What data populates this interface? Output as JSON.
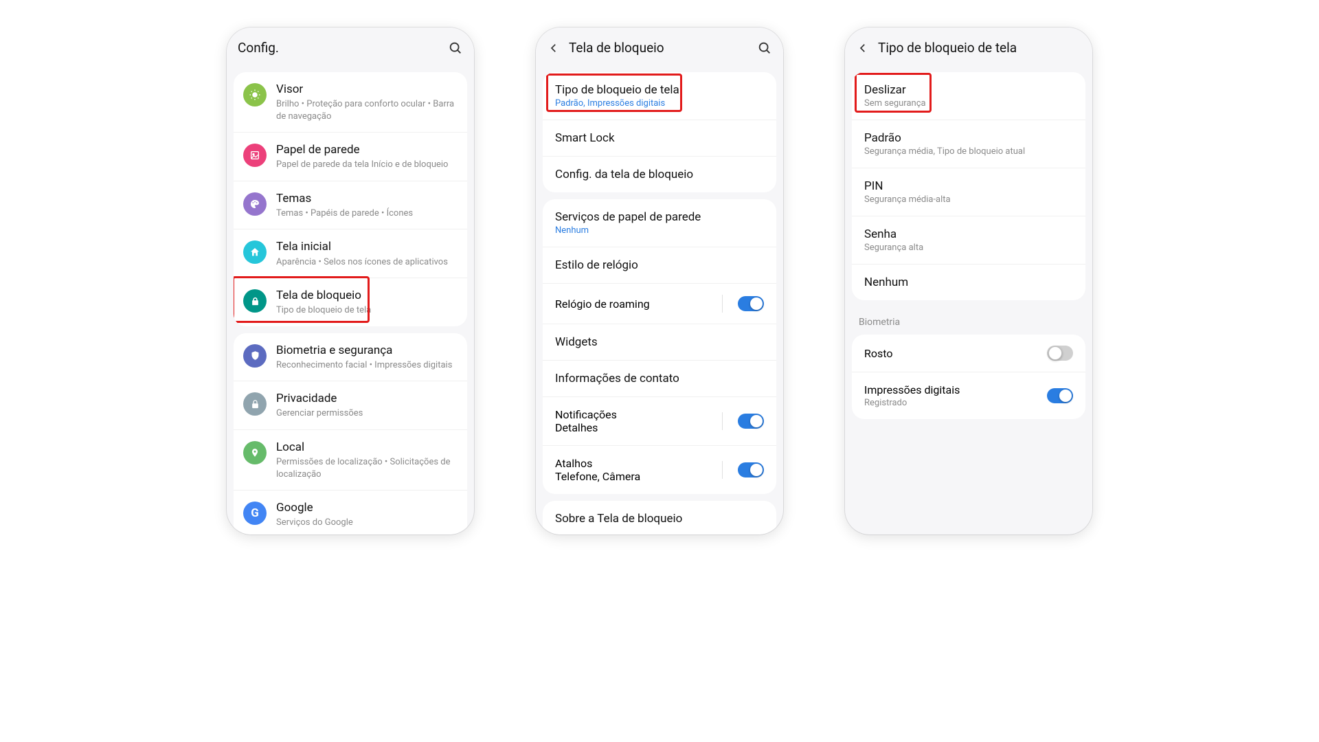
{
  "phone1": {
    "header": {
      "title": "Config."
    },
    "groups": [
      {
        "items": [
          {
            "key": "visor",
            "title": "Visor",
            "sub": "Brilho  •  Proteção para conforto ocular  •  Barra de navegação",
            "iconColor": "#8bc34a"
          },
          {
            "key": "wallpaper",
            "title": "Papel de parede",
            "sub": "Papel de parede da tela Início e de bloqueio",
            "iconColor": "#ec407a"
          },
          {
            "key": "themes",
            "title": "Temas",
            "sub": "Temas  •  Papéis de parede  •  Ícones",
            "iconColor": "#9575cd"
          },
          {
            "key": "home",
            "title": "Tela inicial",
            "sub": "Aparência  •  Selos nos ícones de aplicativos",
            "iconColor": "#26c6da"
          },
          {
            "key": "lock",
            "title": "Tela de bloqueio",
            "sub": "Tipo de bloqueio de tela",
            "iconColor": "#009688",
            "highlighted": true
          }
        ]
      },
      {
        "items": [
          {
            "key": "biometrics",
            "title": "Biometria e segurança",
            "sub": "Reconhecimento facial  •  Impressões digitais",
            "iconColor": "#5c6bc0"
          },
          {
            "key": "privacy",
            "title": "Privacidade",
            "sub": "Gerenciar permissões",
            "iconColor": "#90a4ae"
          },
          {
            "key": "location",
            "title": "Local",
            "sub": "Permissões de localização  •  Solicitações de localização",
            "iconColor": "#66bb6a"
          },
          {
            "key": "google",
            "title": "Google",
            "sub": "Serviços do Google",
            "iconColor": "#4285f4"
          }
        ]
      }
    ]
  },
  "phone2": {
    "header": {
      "title": "Tela de bloqueio"
    },
    "groups": [
      {
        "items": [
          {
            "key": "locktype",
            "title": "Tipo de bloqueio de tela",
            "subLink": "Padrão, Impressões digitais",
            "highlighted": true
          },
          {
            "key": "smartlock",
            "title": "Smart Lock"
          },
          {
            "key": "locksettings",
            "title": "Config. da tela de bloqueio"
          }
        ]
      },
      {
        "items": [
          {
            "key": "wallpaperservices",
            "title": "Serviços de papel de parede",
            "subLink": "Nenhum"
          },
          {
            "key": "clockstyle",
            "title": "Estilo de relógio"
          },
          {
            "key": "roamingclock",
            "title": "Relógio de roaming",
            "toggle": "on"
          },
          {
            "key": "widgets",
            "title": "Widgets"
          },
          {
            "key": "contactinfo",
            "title": "Informações de contato"
          },
          {
            "key": "notifications",
            "title": "Notificações",
            "subLink": "Detalhes",
            "toggle": "on"
          },
          {
            "key": "shortcuts",
            "title": "Atalhos",
            "subLink": "Telefone, Câmera",
            "toggle": "on"
          }
        ]
      },
      {
        "items": [
          {
            "key": "about",
            "title": "Sobre a Tela de bloqueio"
          }
        ]
      }
    ]
  },
  "phone3": {
    "header": {
      "title": "Tipo de bloqueio de tela"
    },
    "groups": [
      {
        "items": [
          {
            "key": "swipe",
            "title": "Deslizar",
            "sub": "Sem segurança",
            "highlighted": true
          },
          {
            "key": "pattern",
            "title": "Padrão",
            "subMixed": {
              "plain": "Segurança média, ",
              "link": "Tipo de bloqueio atual"
            }
          },
          {
            "key": "pin",
            "title": "PIN",
            "sub": "Segurança média-alta"
          },
          {
            "key": "password",
            "title": "Senha",
            "sub": "Segurança alta"
          },
          {
            "key": "none",
            "title": "Nenhum"
          }
        ]
      }
    ],
    "biometricsSection": {
      "label": "Biometria",
      "items": [
        {
          "key": "face",
          "title": "Rosto",
          "toggle": "off"
        },
        {
          "key": "fingerprints",
          "title": "Impressões digitais",
          "sub": "Registrado",
          "toggle": "on"
        }
      ]
    }
  }
}
